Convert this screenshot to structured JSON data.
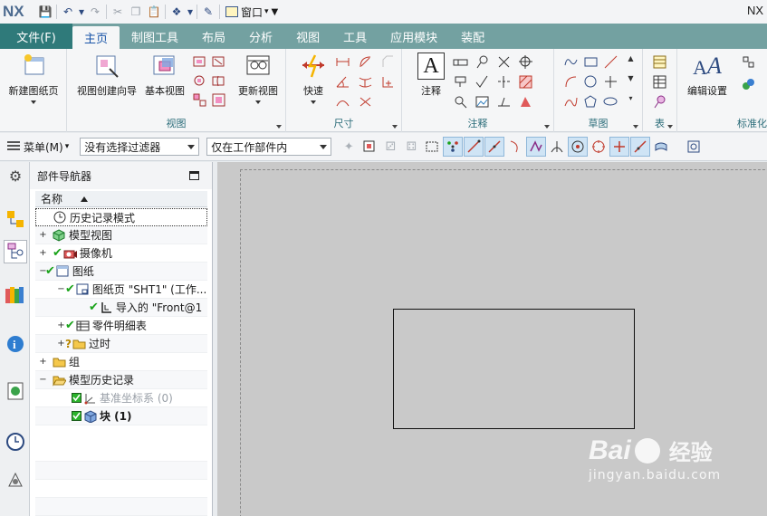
{
  "titlebar": {
    "logo": "NX",
    "window_menu": "窗口",
    "app_name": "NX"
  },
  "menubar": {
    "file": "文件(F)",
    "tabs": [
      "主页",
      "制图工具",
      "布局",
      "分析",
      "视图",
      "工具",
      "应用模块",
      "装配"
    ],
    "active_tab": "主页"
  },
  "ribbon": {
    "new_sheet": "新建图纸页",
    "view_wizard": "视图创建向导",
    "base_view": "基本视图",
    "update_view": "更新视图",
    "group_view": "视图",
    "rapid": "快速",
    "group_dimension": "尺寸",
    "note": "注释",
    "group_annotation": "注释",
    "group_sketch": "草图",
    "group_table": "表",
    "edit_settings": "编辑设置",
    "group_standard": "标准化"
  },
  "selbar": {
    "menu": "菜单(M)",
    "filter": "没有选择过滤器",
    "scope": "仅在工作部件内"
  },
  "navigator": {
    "title": "部件导航器",
    "column_name": "名称",
    "rows": [
      "历史记录模式",
      "模型视图",
      "摄像机",
      "图纸",
      "图纸页 \"SHT1\" (工作...",
      "导入的 \"Front@1",
      "零件明细表",
      "过时",
      "组",
      "模型历史记录",
      "基准坐标系 (0)",
      "块 (1)"
    ]
  },
  "watermark": {
    "brand": "Bai",
    "brand2": "经验",
    "url": "jingyan.baidu.com"
  },
  "colors": {
    "menubar": "#73a1a1",
    "file_tab": "#2f7a7a",
    "canvas": "#c9c9c9",
    "check_green": "#1aa31a"
  }
}
